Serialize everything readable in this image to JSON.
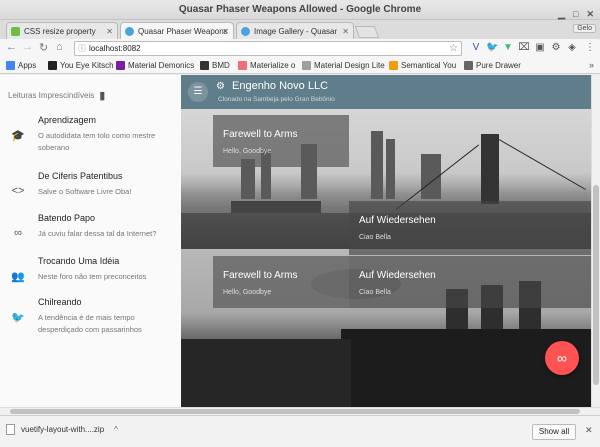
{
  "window": {
    "title": "Quasar Phaser Weapons Allowed - Google Chrome"
  },
  "tabs": [
    {
      "label": "CSS resize property",
      "color": "#6bbf44"
    },
    {
      "label": "Quasar Phaser Weapons",
      "color": "#4aa3df"
    },
    {
      "label": "Image Gallery - Quasar",
      "color": "#4aa3df"
    }
  ],
  "profile": {
    "label": "Gelo"
  },
  "toolbar": {
    "url": "localhost:8082"
  },
  "bookmarks": [
    {
      "label": "Apps",
      "color": "#4285f4"
    },
    {
      "label": "You Eye Kitsch",
      "color": "#222222"
    },
    {
      "label": "Material Demonics",
      "color": "#7b1fa2"
    },
    {
      "label": "BMD",
      "color": "#333333"
    },
    {
      "label": "Materialize o",
      "color": "#ee6e73"
    },
    {
      "label": "Material Design Lite",
      "color": "#9e9e9e"
    },
    {
      "label": "Semantical You",
      "color": "#f39c12"
    },
    {
      "label": "Pure Drawer",
      "color": "#666666"
    }
  ],
  "drawer": {
    "header": "Leituras Imprescindíveis",
    "items": [
      {
        "title": "Aprendizagem",
        "subtitle": "O autodidata tem tolo como mestre soberano",
        "icon": "school-icon"
      },
      {
        "title": "De Ciferis Patentibus",
        "subtitle": "Salve o Software Livre Oba!",
        "icon": "code-icon"
      },
      {
        "title": "Batendo Papo",
        "subtitle": "Já cuviu falar dessa tal da Internet?",
        "icon": "infinity-icon"
      },
      {
        "title": "Trocando Uma Idéia",
        "subtitle": "Neste foro não tem preconceitos",
        "icon": "people-icon"
      },
      {
        "title": "Chilreando",
        "subtitle": "A tendência é de mais tempo desperdiçado com passarinhos",
        "icon": "twitter-icon"
      }
    ]
  },
  "appbar": {
    "title": "Engenho Novo LLC",
    "subtitle": "Clonado na Sambeja pelo Gran Bebônio"
  },
  "gallery": [
    {
      "title": "Farewell to Arms",
      "subtitle": "Hello, Goodbye"
    },
    {
      "title": "Auf Wiedersehen",
      "subtitle": "Ciao Bella"
    },
    {
      "title": "Farewell to Arms",
      "subtitle": "Hello, Goodbye"
    },
    {
      "title": "Auf Wiedersehen",
      "subtitle": "Ciao Bella"
    }
  ],
  "fab": {
    "icon": "infinity-icon",
    "color": "#ff5252"
  },
  "downloads": {
    "file": "vuetify-layout-with....zip",
    "show_all": "Show all"
  }
}
